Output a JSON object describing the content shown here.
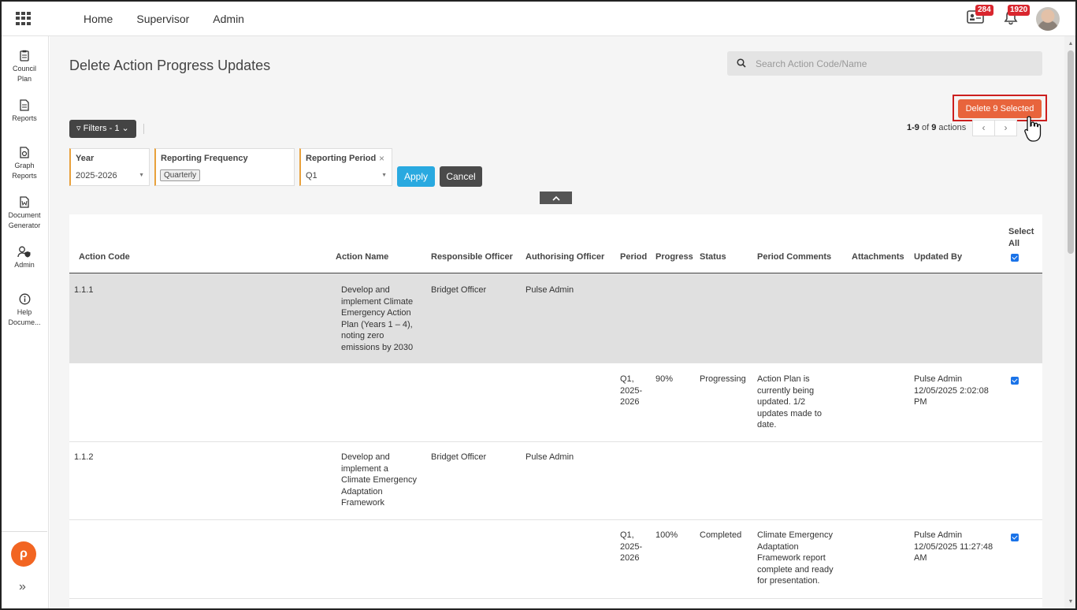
{
  "nav": {
    "items": [
      "Home",
      "Supervisor",
      "Admin"
    ]
  },
  "notifications": {
    "messages_badge": "284",
    "alerts_badge": "1920"
  },
  "sidebar": {
    "items": [
      {
        "label_line1": "Council",
        "label_line2": "Plan",
        "icon": "clipboard-icon"
      },
      {
        "label_line1": "Reports",
        "label_line2": "",
        "icon": "document-icon"
      },
      {
        "label_line1": "Graph",
        "label_line2": "Reports",
        "icon": "graph-document-icon"
      },
      {
        "label_line1": "Document",
        "label_line2": "Generator",
        "icon": "word-document-icon"
      },
      {
        "label_line1": "Admin",
        "label_line2": "",
        "icon": "user-shield-icon"
      },
      {
        "label_line1": "Help",
        "label_line2": "Docume...",
        "icon": "info-icon"
      }
    ],
    "logo": "ρ",
    "expand": "»"
  },
  "page": {
    "title": "Delete Action Progress Updates",
    "search_placeholder": "Search Action Code/Name",
    "delete_button": "Delete 9 Selected",
    "filters_button": "Filters - 1",
    "paging": {
      "range": "1-9",
      "of": "of",
      "total": "9",
      "suffix": "actions",
      "prev": "‹",
      "next": "›"
    },
    "filters": {
      "year": {
        "label": "Year",
        "value": "2025-2026"
      },
      "frequency": {
        "label": "Reporting Frequency",
        "chip": "Quarterly"
      },
      "period": {
        "label": "Reporting Period",
        "value": "Q1",
        "clear": "×"
      }
    },
    "apply": "Apply",
    "cancel": "Cancel",
    "collapse": "⌃"
  },
  "table": {
    "headers": {
      "action_code": "Action Code",
      "action_name": "Action Name",
      "responsible": "Responsible Officer",
      "authorising": "Authorising Officer",
      "period": "Period",
      "progress": "Progress",
      "status": "Status",
      "comments": "Period Comments",
      "attachments": "Attachments",
      "updated_by": "Updated By",
      "select_all_1": "Select",
      "select_all_2": "All"
    },
    "rows": [
      {
        "code": "1.1.1",
        "name_lines": [
          "Develop and",
          "implement Climate",
          "Emergency Action",
          "Plan (Years 1 – 4),",
          "noting zero",
          "emissions by 2030"
        ],
        "responsible": "Bridget Officer",
        "authorising": "Pulse Admin"
      },
      {
        "period_lines": [
          "Q1,",
          "2025-",
          "2026"
        ],
        "progress": "90%",
        "status": "Progressing",
        "comment_lines": [
          "Action Plan is",
          "currently being",
          "updated. 1/2",
          "updates made to",
          "date."
        ],
        "updated_lines": [
          "Pulse Admin",
          "12/05/2025 2:02:08",
          "PM"
        ]
      },
      {
        "code": "1.1.2",
        "name_lines": [
          "Develop and",
          "implement a",
          "Climate Emergency",
          "Adaptation",
          "Framework"
        ],
        "responsible": "Bridget Officer",
        "authorising": "Pulse Admin"
      },
      {
        "period_lines": [
          "Q1,",
          "2025-",
          "2026"
        ],
        "progress": "100%",
        "status": "Completed",
        "comment_lines": [
          "Climate Emergency",
          "Adaptation",
          "Framework report",
          "complete and ready",
          "for presentation."
        ],
        "updated_lines": [
          "Pulse Admin",
          "12/05/2025 11:27:48",
          "AM"
        ]
      }
    ]
  }
}
